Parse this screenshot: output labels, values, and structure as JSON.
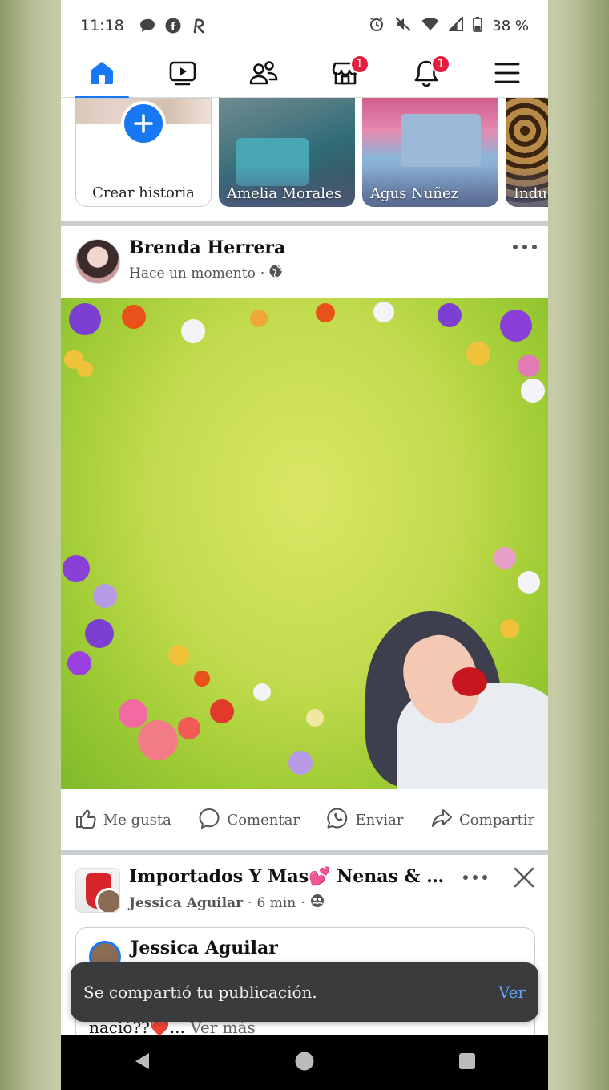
{
  "status_bar": {
    "time": "11:18",
    "battery": "38 %",
    "icons": [
      "chat-bubble-icon",
      "facebook-icon",
      "r-app-icon",
      "alarm-icon",
      "mute-icon",
      "wifi-icon",
      "signal-icon",
      "battery-icon"
    ]
  },
  "nav": {
    "items": [
      {
        "name": "home",
        "icon": "home-icon",
        "active": true
      },
      {
        "name": "video",
        "icon": "video-icon"
      },
      {
        "name": "friends",
        "icon": "friends-icon"
      },
      {
        "name": "marketplace",
        "icon": "marketplace-icon",
        "badge": "1"
      },
      {
        "name": "notifications",
        "icon": "bell-icon",
        "badge": "1"
      },
      {
        "name": "menu",
        "icon": "menu-icon"
      }
    ]
  },
  "stories": {
    "create_label": "Crear historia",
    "items": [
      {
        "name": "Amelia Morales"
      },
      {
        "name": "Agus Nuñez"
      },
      {
        "name": "Indu"
      }
    ]
  },
  "post1": {
    "author": "Brenda Herrera",
    "time": "Hace un momento",
    "separator": "·",
    "privacy_icon": "globe-icon"
  },
  "actions": {
    "like": "Me gusta",
    "comment": "Comentar",
    "send": "Enviar",
    "share": "Compartir"
  },
  "post2": {
    "group_name": "Importados Y Mas💕 Nenas & Nene...",
    "poster": "Jessica Aguilar",
    "time": "6 min",
    "separator": "·",
    "shared_author": "Jessica Aguilar",
    "shared_text": "nació??❤️...",
    "see_more": "Ver más"
  },
  "toast": {
    "message": "Se compartió tu publicación.",
    "action": "Ver"
  },
  "colors": {
    "accent": "#1877f2",
    "badge": "#e41e3f",
    "toast_bg": "#3a3b3c",
    "toast_action": "#5fa4f5"
  }
}
